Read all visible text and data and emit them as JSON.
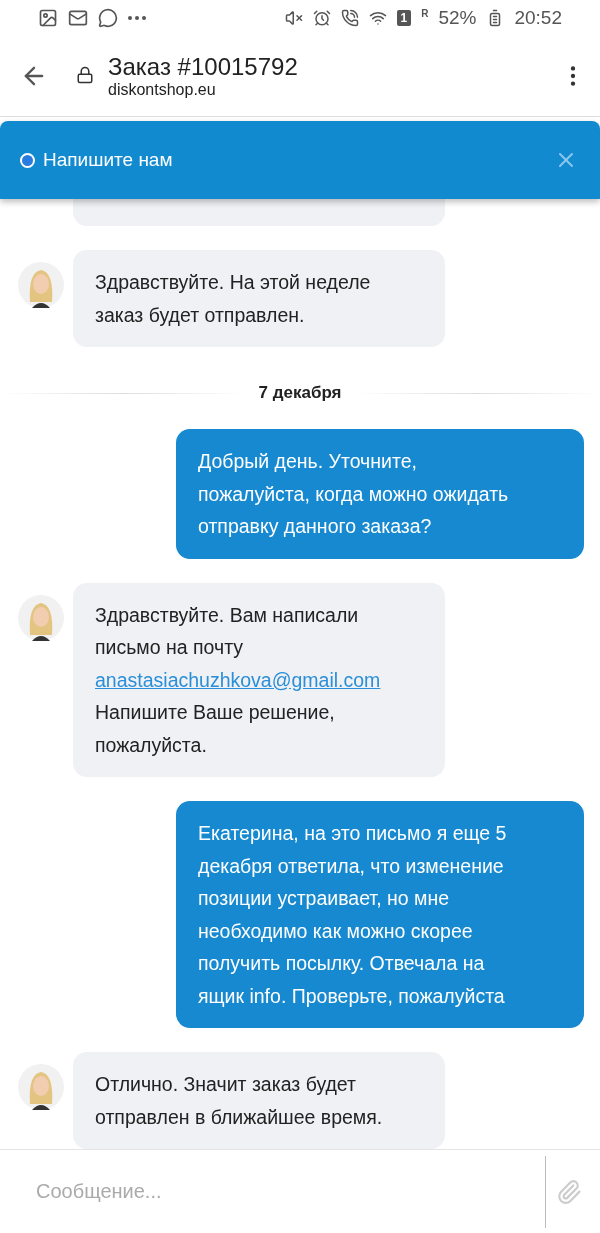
{
  "status_bar": {
    "sim_badge": "1",
    "roaming": "R",
    "battery": "52%",
    "time": "20:52"
  },
  "header": {
    "title": "Заказ #10015792",
    "subtitle": "diskontshop.eu"
  },
  "chat_banner": {
    "title": "Напишите нам",
    "online": false
  },
  "messages": [
    {
      "kind": "cut"
    },
    {
      "kind": "incoming",
      "text": "Здравствуйте. На этой неделе\nзаказ будет отправлен."
    },
    {
      "kind": "date",
      "text": "7 декабря"
    },
    {
      "kind": "outgoing",
      "text": "Добрый день. Уточните,\nпожалуйста, когда можно ожидать\nотправку данного заказа?"
    },
    {
      "kind": "incoming",
      "text": "Здравствуйте. Вам написали\nписьмо на почту",
      "link": "anastasiachuzhkova@gmail.com",
      "after": "Напишите Ваше решение,\nпожалуйста."
    },
    {
      "kind": "outgoing",
      "text": "Екатерина, на это письмо я еще 5\nдекабря ответила, что изменение\nпозиции устраивает, но мне\nнеобходимо как можно скорее\nполучить посылку. Отвечала на\nящик info. Проверьте, пожалуйста"
    },
    {
      "kind": "incoming",
      "text": "Отлично. Значит заказ будет\nотправлен в ближайшее время."
    }
  ],
  "composer": {
    "placeholder": "Сообщение..."
  }
}
